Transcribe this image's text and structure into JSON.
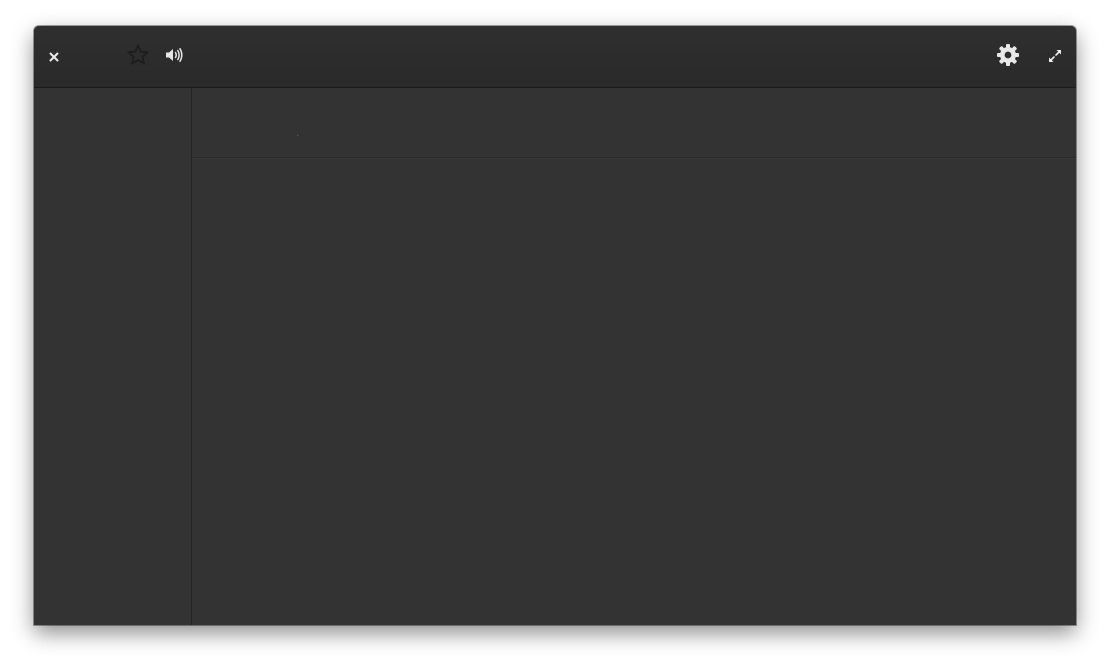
{
  "window": {
    "titlebar": {
      "icons": {
        "close": "close-icon",
        "favorite": "star-outline-icon",
        "volume": "volume-icon",
        "settings": "gear-icon",
        "fullscreen": "fullscreen-icon"
      }
    },
    "content": {
      "title": "."
    }
  },
  "colors": {
    "window_background": "#333333",
    "titlebar_background": "#2d2d2d",
    "icon_light": "#e6e6e6",
    "icon_dark": "#1e1e1e"
  }
}
